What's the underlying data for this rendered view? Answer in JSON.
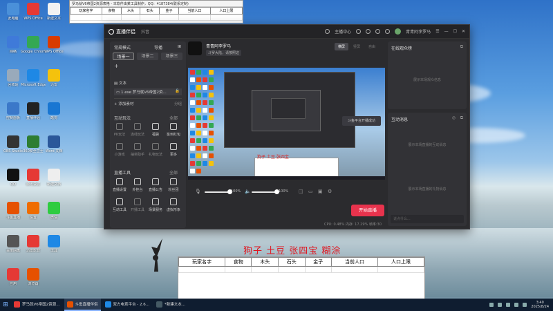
{
  "desktop": {
    "icons": [
      {
        "label": "此电脑",
        "color": "#4a90d9"
      },
      {
        "label": "WPS Office",
        "color": "#e53935"
      },
      {
        "label": "新建文本",
        "color": "#f2f2f2"
      },
      {
        "label": "网络",
        "color": "#3f7ad9"
      },
      {
        "label": "Google Chrome",
        "color": "#34a853"
      },
      {
        "label": "WPS Office",
        "color": "#d83b01"
      },
      {
        "label": "回收站",
        "color": "#9ab"
      },
      {
        "label": "Microsoft Edge",
        "color": "#1e88e5"
      },
      {
        "label": "迅雷",
        "color": "#f4c20d"
      },
      {
        "label": "控制面板",
        "color": "#3b78c9"
      },
      {
        "label": "直播伴侣",
        "color": "#222"
      },
      {
        "label": "酷狗",
        "color": "#1976d2"
      },
      {
        "label": "OBS Studio",
        "color": "#333"
      },
      {
        "label": "360安全卫士",
        "color": "#2e7d32"
      },
      {
        "label": "Word 文档",
        "color": "#2b579a"
      },
      {
        "label": "QQ",
        "color": "#111"
      },
      {
        "label": "腾讯会议",
        "color": "#e53935"
      },
      {
        "label": "新建文档",
        "color": "#eee"
      },
      {
        "label": "斗鱼直播",
        "color": "#e65100"
      },
      {
        "label": "设置",
        "color": "#ef6c00"
      },
      {
        "label": "微信",
        "color": "#2ecc40"
      },
      {
        "label": "百度网盘",
        "color": "#555"
      },
      {
        "label": "迅雷影音",
        "color": "#e53935"
      },
      {
        "label": "工具",
        "color": "#1e88e5"
      },
      {
        "label": "应用",
        "color": "#e53935"
      },
      {
        "label": "浏览器",
        "color": "#e65100"
      }
    ],
    "red_caption": "狗子 土豆 张四宝 糊涂",
    "top_sheet_title": "罗马就V6帝国2资源表格 - 本软件由某工具制作，QQ：4187384(联系定制)",
    "sheet_headers": [
      "玩家名字",
      "食物",
      "木头",
      "石头",
      "金子",
      "当前人口",
      "人口上限"
    ]
  },
  "app": {
    "title": "直播伴侣",
    "subtitle": "抖音",
    "top_right": {
      "center_label": "主播中心",
      "username": "青青阿李罗马"
    },
    "left_panel": {
      "mode_label": "常规模式",
      "guide_label": "导播",
      "scenes": [
        "场景一",
        "场景二",
        "场景三"
      ],
      "sources_header": "文本",
      "source_item": "1.exe 罗马就V6帝国2资...",
      "add_source": "添加素材",
      "add_source_right": "分组",
      "interact_title": "互动玩法",
      "all_label": "全部",
      "interact_items": [
        "PK玩法",
        "连线玩法",
        "福袋",
        "签到红包",
        "小游戏",
        "抽奖助手",
        "礼物玩法",
        "更多"
      ],
      "tools_title": "直播工具",
      "tools_items": [
        "直播设置",
        "外挂台",
        "直播公告",
        "粉丝团",
        "互动工具",
        "开播工具",
        "场景服务",
        "虚拟形象"
      ]
    },
    "center": {
      "stream_name": "青青阿李罗马",
      "stream_tag": "斗罗大陆，请按照这",
      "view_modes": [
        "横屏",
        "竖屏",
        "自由"
      ],
      "preview_toast": "斗鱼平台开播成功",
      "preview_red_text": "狗子 土豆 张四宝",
      "vol1": "100%",
      "vol2": "100%",
      "vol1_value": 100,
      "vol2_value": 100,
      "start_button": "开始直播",
      "stats": "CPU: 0.48%    内存: 17.29%    帧率:30"
    },
    "right_panel": {
      "online_title": "在线观众榜",
      "online_empty": "展示本场观众信息",
      "messages_title": "互动消息",
      "messages_empty": "展示本场直播的互动消息",
      "gift_empty": "展示本场直播的礼物消息",
      "input_placeholder": "说点什么..."
    }
  },
  "taskbar": {
    "items": [
      {
        "label": "罗马就V6帝国2资源...",
        "color": "#e53935",
        "active": false
      },
      {
        "label": "斗鱼直播伴侣",
        "color": "#e65100",
        "active": true
      },
      {
        "label": "双方电竞平台 - 2.6...",
        "color": "#1e88e5",
        "active": false
      },
      {
        "label": "*新建文本...",
        "color": "#455a64",
        "active": false
      }
    ],
    "time": "3:40",
    "date": "2025/8/24"
  }
}
